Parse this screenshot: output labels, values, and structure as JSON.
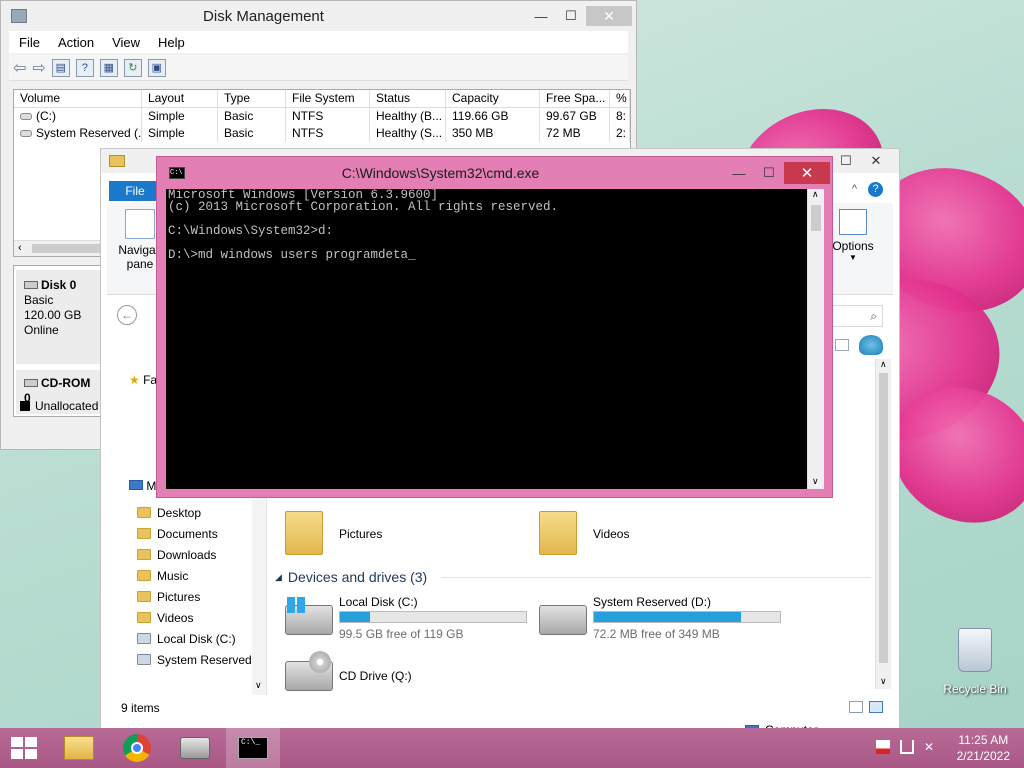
{
  "desktop": {
    "recycle_bin_label": "Recycle Bin"
  },
  "disk_management": {
    "title": "Disk Management",
    "menu": [
      "File",
      "Action",
      "View",
      "Help"
    ],
    "columns": [
      "Volume",
      "Layout",
      "Type",
      "File System",
      "Status",
      "Capacity",
      "Free Spa...",
      "%"
    ],
    "rows": [
      [
        "(C:)",
        "Simple",
        "Basic",
        "NTFS",
        "Healthy (B...",
        "119.66 GB",
        "99.67 GB",
        "8:"
      ],
      [
        "System Reserved (...",
        "Simple",
        "Basic",
        "NTFS",
        "Healthy (S...",
        "350 MB",
        "72 MB",
        "2:"
      ]
    ],
    "disk0": {
      "name": "Disk 0",
      "type": "Basic",
      "size": "120.00 GB",
      "status": "Online"
    },
    "cdrom": {
      "name": "CD-ROM 0",
      "legend": "Unallocated"
    }
  },
  "explorer": {
    "file_tab": "File",
    "nav_pane_label_1": "Navigati",
    "nav_pane_label_2": "pane",
    "options_label": "Options",
    "nav_items": [
      "Desktop",
      "Documents",
      "Downloads",
      "Music",
      "Pictures",
      "Videos",
      "Local Disk (C:)",
      "System Reserved"
    ],
    "folders": [
      "Pictures",
      "Videos"
    ],
    "devices_heading": "Devices and drives (3)",
    "drives": [
      {
        "name": "Local Disk (C:)",
        "free": "99.5 GB free of 119 GB",
        "used_fraction": 0.16
      },
      {
        "name": "System Reserved (D:)",
        "free": "72.2 MB free of 349 MB",
        "used_fraction": 0.79
      },
      {
        "name": "CD Drive (Q:)",
        "free": "",
        "used_fraction": 0
      }
    ],
    "status_items": "9 items",
    "computer_label": "Computer"
  },
  "cmd": {
    "title": "C:\\Windows\\System32\\cmd.exe",
    "lines": [
      "Microsoft Windows [Version 6.3.9600]",
      "(c) 2013 Microsoft Corporation. All rights reserved.",
      "",
      "C:\\Windows\\System32>d:",
      "",
      "D:\\>md windows users programdeta_"
    ]
  },
  "taskbar": {
    "time": "11:25 AM",
    "date": "2/21/2022"
  },
  "colors": {
    "accent": "#1979ca",
    "cmd_frame": "#e37fb5",
    "taskbar": "#b0628f",
    "close": "#c8394d"
  }
}
